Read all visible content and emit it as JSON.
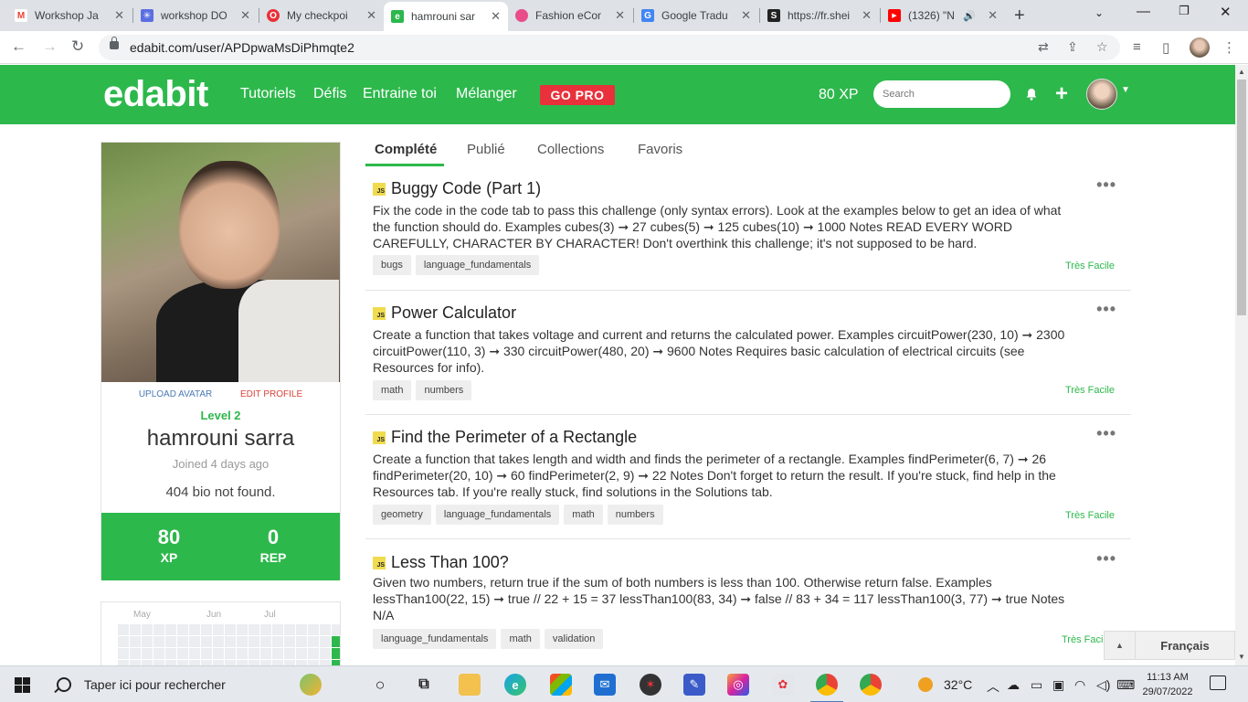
{
  "browser": {
    "tabs": [
      {
        "title": "Workshop Ja",
        "favicon": "gmail-icon",
        "color": "#ea4335",
        "glyph": "M"
      },
      {
        "title": "workshop DO",
        "favicon": "asterisk-icon",
        "color": "#5b6ee1",
        "glyph": "✳"
      },
      {
        "title": "My checkpoi",
        "favicon": "opera-icon",
        "color": "#e8313b",
        "glyph": "O"
      },
      {
        "title": "hamrouni sar",
        "favicon": "edabit-icon",
        "color": "#2db84c",
        "glyph": "e"
      },
      {
        "title": "Fashion eCon",
        "favicon": "dribbble-icon",
        "color": "#e94c89",
        "glyph": "●"
      },
      {
        "title": "Google Tradu",
        "favicon": "google-translate-icon",
        "color": "#4285f4",
        "glyph": "G"
      },
      {
        "title": "https://fr.shei",
        "favicon": "shein-icon",
        "color": "#222222",
        "glyph": "S"
      },
      {
        "title": "(1326) \"N",
        "favicon": "youtube-icon",
        "color": "#ff0000",
        "glyph": "▶"
      }
    ],
    "url": "edabit.com/user/APDpwaMsDiPhmqte2"
  },
  "header": {
    "logo": "edabit",
    "nav": [
      "Tutoriels",
      "Défis",
      "Entraine toi",
      "Mélanger"
    ],
    "gopro": "GO PRO",
    "xp": "80 XP",
    "search_placeholder": "Search"
  },
  "profile": {
    "upload_avatar": "UPLOAD AVATAR",
    "edit_profile": "EDIT PROFILE",
    "level": "Level 2",
    "name": "hamrouni sarra",
    "joined": "Joined 4 days ago",
    "bio": "404 bio not found.",
    "stats": [
      {
        "value": "80",
        "label": "XP"
      },
      {
        "value": "0",
        "label": "REP"
      }
    ],
    "heatmap_months": [
      "May",
      "Jun",
      "Jul"
    ]
  },
  "content_tabs": [
    "Complété",
    "Publié",
    "Collections",
    "Favoris"
  ],
  "challenges": [
    {
      "title": "Buggy Code (Part 1)",
      "description": "Fix the code in the code tab to pass this challenge (only syntax errors). Look at the examples below to get an idea of what the function should do. Examples cubes(3) ➞ 27 cubes(5) ➞ 125 cubes(10) ➞ 1000 Notes READ EVERY WORD CAREFULLY, CHARACTER BY CHARACTER! Don't overthink this challenge; it's not supposed to be hard.",
      "tags": [
        "bugs",
        "language_fundamentals"
      ],
      "difficulty": "Très Facile"
    },
    {
      "title": "Power Calculator",
      "description": "Create a function that takes voltage and current and returns the calculated power. Examples circuitPower(230, 10) ➞ 2300 circuitPower(110, 3) ➞ 330 circuitPower(480, 20) ➞ 9600 Notes Requires basic calculation of electrical circuits (see Resources for info).",
      "tags": [
        "math",
        "numbers"
      ],
      "difficulty": "Très Facile"
    },
    {
      "title": "Find the Perimeter of a Rectangle",
      "description": "Create a function that takes length and width and finds the perimeter of a rectangle. Examples findPerimeter(6, 7) ➞ 26 findPerimeter(20, 10) ➞ 60 findPerimeter(2, 9) ➞ 22 Notes Don't forget to return the result. If you're stuck, find help in the Resources tab. If you're really stuck, find solutions in the Solutions tab.",
      "tags": [
        "geometry",
        "language_fundamentals",
        "math",
        "numbers"
      ],
      "difficulty": "Très Facile"
    },
    {
      "title": "Less Than 100?",
      "description": "Given two numbers, return true if the sum of both numbers is less than 100. Otherwise return false. Examples lessThan100(22, 15) ➞ true // 22 + 15 = 37 lessThan100(83, 34) ➞ false // 83 + 34 = 117 lessThan100(3, 77) ➞ true Notes N/A",
      "tags": [
        "language_fundamentals",
        "math",
        "validation"
      ],
      "difficulty": "Très Faci"
    }
  ],
  "language": "Français",
  "taskbar": {
    "search": "Taper ici pour rechercher",
    "temperature": "32°C",
    "time": "11:13 AM",
    "date": "29/07/2022"
  },
  "colors": {
    "brand_green": "#2db84c",
    "gopro_red": "#e8313b"
  }
}
